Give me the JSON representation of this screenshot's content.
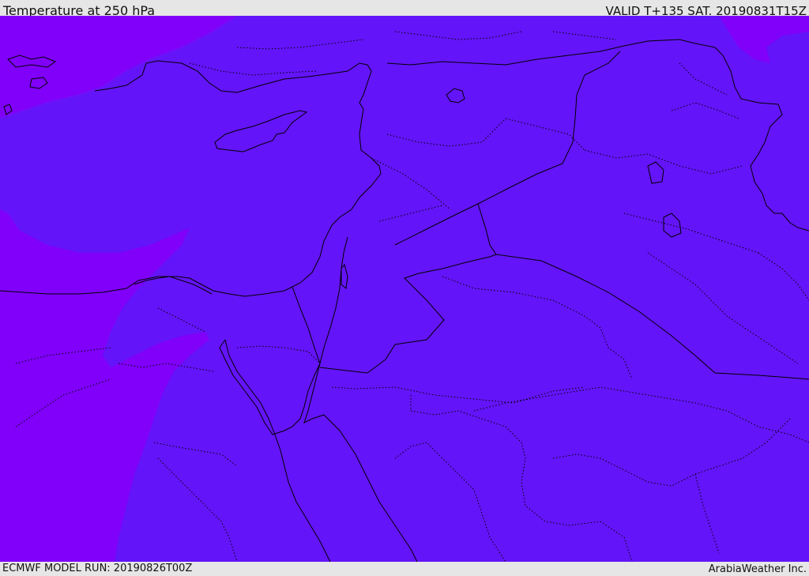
{
  "header": {
    "title": "Temperature at 250 hPa",
    "valid_time": "VALID T+135 SAT. 20190831T15Z"
  },
  "footer": {
    "model_run": "ECMWF MODEL RUN: 20190826T00Z",
    "provider": "ArabiaWeather Inc."
  },
  "colors": {
    "field_main": "#6414f8",
    "field_warm_band": "#8000fa",
    "field_transition": "#6e10f8",
    "coastline": "#000000",
    "borders": "#000000",
    "bars": "#e6e6e6"
  },
  "layers": [
    "temperature-field",
    "coastlines",
    "country-borders",
    "subregion-borders"
  ]
}
